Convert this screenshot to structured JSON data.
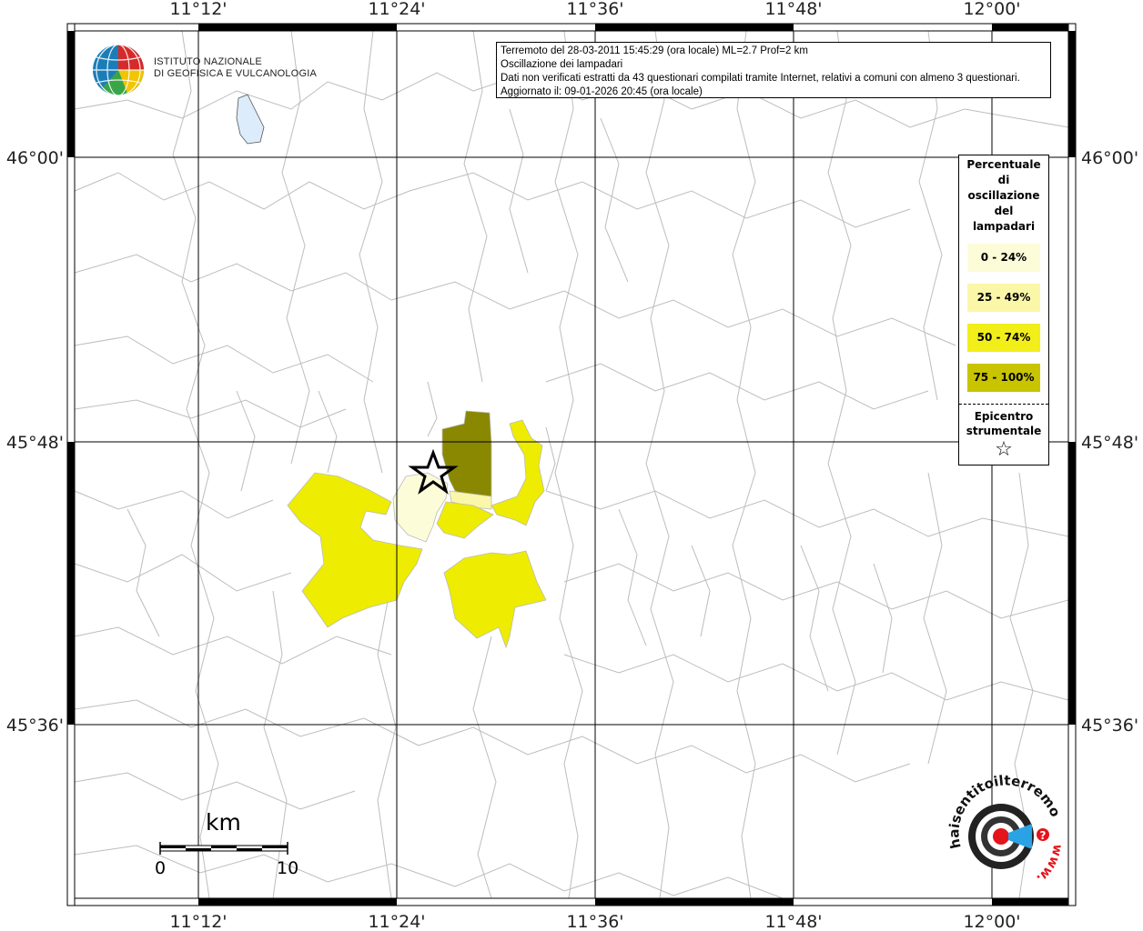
{
  "header": {
    "line1": "Terremoto del 28-03-2011 15:45:29 (ora locale) ML=2.7 Prof=2 km",
    "line2": "Oscillazione dei lampadari",
    "line3": "Dati non verificati estratti da 43 questionari compilati tramite Internet, relativi a comuni con almeno 3 questionari.",
    "line4": "Aggiornato il: 09-01-2026 20:45 (ora locale)"
  },
  "institute": {
    "line1": "ISTITUTO NAZIONALE",
    "line2": "DI GEOFISICA E VULCANOLOGIA"
  },
  "axes": {
    "longitude_ticks": [
      "11°12'",
      "11°24'",
      "11°36'",
      "11°48'",
      "12°00'"
    ],
    "latitude_ticks": [
      "46°00'",
      "45°48'",
      "45°36'"
    ]
  },
  "legend": {
    "title_lines": [
      "Percentuale",
      "di",
      "oscillazione",
      "del",
      "lampadari"
    ],
    "classes": [
      {
        "label": "0 - 24%",
        "color": "#fdfcd9"
      },
      {
        "label": "25 - 49%",
        "color": "#fbf7a8"
      },
      {
        "label": "50 - 74%",
        "color": "#f2ee1a"
      },
      {
        "label": "75 - 100%",
        "color": "#c9c400"
      }
    ],
    "epicenter_lines": [
      "Epicentro",
      "strumentale"
    ],
    "epicenter_symbol": "☆"
  },
  "scale": {
    "unit": "km",
    "start": "0",
    "end": "10"
  },
  "watermark": {
    "text": "haisentitoilterremoto.it",
    "url": "www."
  },
  "colors": {
    "class_0": "#fdfcd9",
    "class_1": "#fbf7a8",
    "class_2": "#eeec00",
    "class_3": "#8a8800",
    "lake": "#dcecfa",
    "border": "#bfbfbf"
  }
}
